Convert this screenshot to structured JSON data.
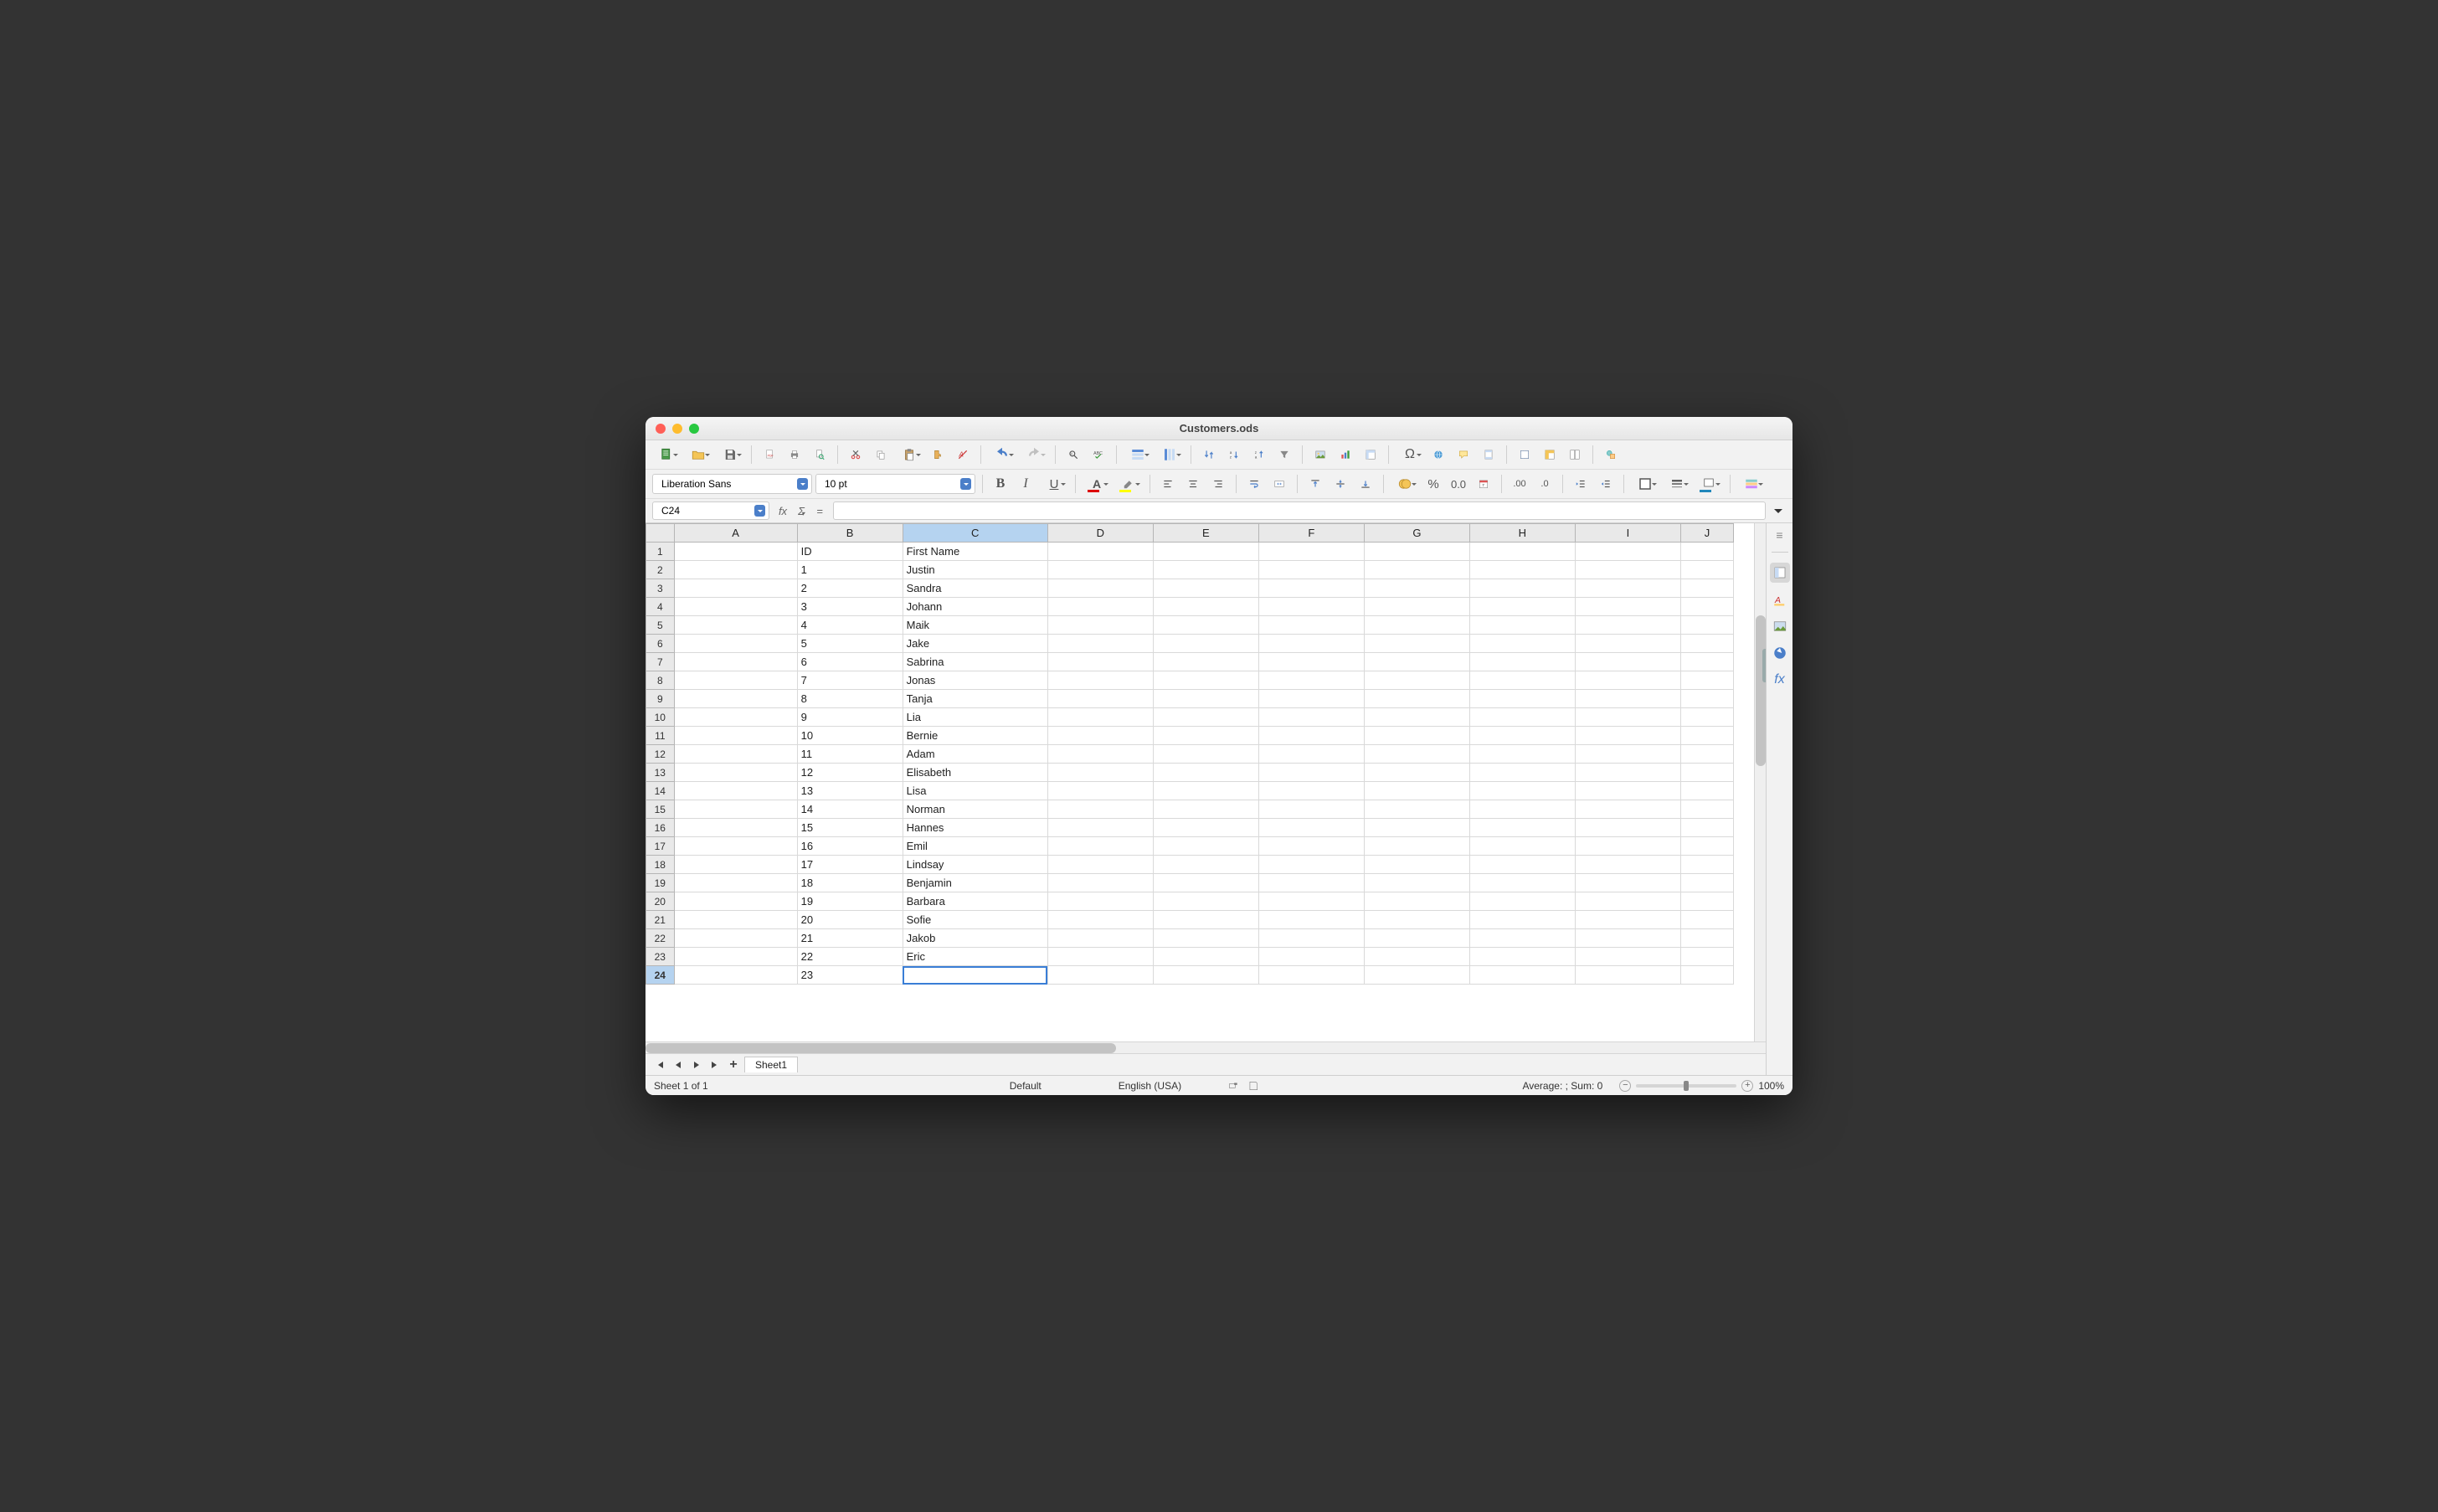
{
  "window": {
    "title": "Customers.ods"
  },
  "formatBar": {
    "fontName": "Liberation Sans",
    "fontSize": "10 pt"
  },
  "formulaBar": {
    "cellRef": "C24",
    "fx": "fx",
    "sigma": "Σ",
    "equals": "=",
    "formula": ""
  },
  "columns": [
    "A",
    "B",
    "C",
    "D",
    "E",
    "F",
    "G",
    "H",
    "I",
    "J"
  ],
  "selectedColumn": "C",
  "selectedRow": 24,
  "rowCount": 24,
  "sheet": {
    "headerRow": {
      "B": "ID",
      "C": "First Name"
    },
    "data": [
      {
        "id": "1",
        "first": "Justin"
      },
      {
        "id": "2",
        "first": "Sandra"
      },
      {
        "id": "3",
        "first": "Johann"
      },
      {
        "id": "4",
        "first": "Maik"
      },
      {
        "id": "5",
        "first": "Jake"
      },
      {
        "id": "6",
        "first": "Sabrina"
      },
      {
        "id": "7",
        "first": "Jonas"
      },
      {
        "id": "8",
        "first": "Tanja"
      },
      {
        "id": "9",
        "first": "Lia"
      },
      {
        "id": "10",
        "first": "Bernie"
      },
      {
        "id": "11",
        "first": "Adam"
      },
      {
        "id": "12",
        "first": "Elisabeth"
      },
      {
        "id": "13",
        "first": "Lisa"
      },
      {
        "id": "14",
        "first": "Norman"
      },
      {
        "id": "15",
        "first": "Hannes"
      },
      {
        "id": "16",
        "first": "Emil"
      },
      {
        "id": "17",
        "first": "Lindsay"
      },
      {
        "id": "18",
        "first": "Benjamin"
      },
      {
        "id": "19",
        "first": "Barbara"
      },
      {
        "id": "20",
        "first": "Sofie"
      },
      {
        "id": "21",
        "first": "Jakob"
      },
      {
        "id": "22",
        "first": "Eric"
      },
      {
        "id": "23",
        "first": ""
      }
    ]
  },
  "tabs": {
    "sheet1": "Sheet1"
  },
  "status": {
    "sheetCount": "Sheet 1 of 1",
    "style": "Default",
    "language": "English (USA)",
    "summary": "Average: ; Sum: 0",
    "zoom": "100%"
  }
}
